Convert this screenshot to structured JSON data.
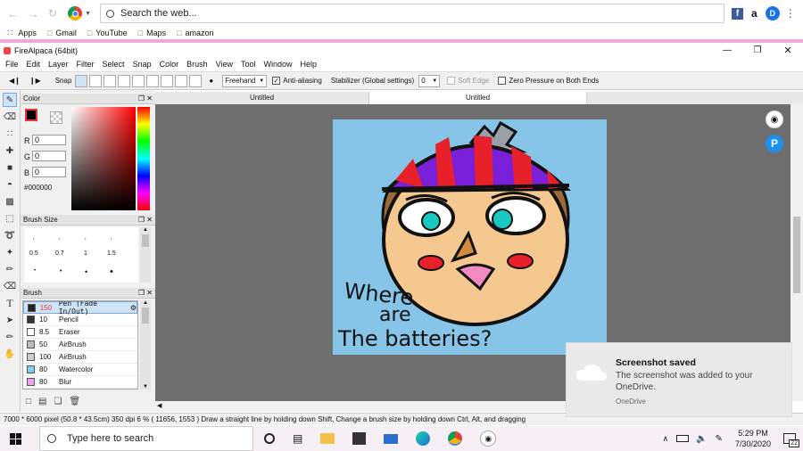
{
  "browser": {
    "omnibox_placeholder": "Search the web...",
    "bookmarks": [
      "Apps",
      "Gmail",
      "YouTube",
      "Maps",
      "amazon"
    ],
    "ext_amazon": "a",
    "ext_profile": "D"
  },
  "app": {
    "title": "FireAlpaca (64bit)",
    "menu": [
      "File",
      "Edit",
      "Layer",
      "Filter",
      "Select",
      "Snap",
      "Color",
      "Brush",
      "View",
      "Tool",
      "Window",
      "Help"
    ]
  },
  "toolbar": {
    "snap_label": "Snap",
    "mode_select": "Freehand",
    "antialias_label": "Anti-aliasing",
    "antialias_checked": true,
    "stabilizer_label": "Stabilizer (Global settings)",
    "stabilizer_value": "0",
    "soft_edge_label": "Soft Edge",
    "zero_pressure_label": "Zero Pressure on Both Ends"
  },
  "tabs": [
    "Untitled",
    "Untitled"
  ],
  "color_panel": {
    "title": "Color",
    "r_label": "R",
    "r_value": "0",
    "g_label": "G",
    "g_value": "0",
    "b_label": "B",
    "b_value": "0",
    "hex": "#000000"
  },
  "brush_size_panel": {
    "title": "Brush Size",
    "sizes": [
      "0.5",
      "0.7",
      "1",
      "1.5"
    ]
  },
  "brush_panel": {
    "title": "Brush",
    "items": [
      {
        "size": "150",
        "name": "Pen (Fade In/Out)",
        "color": "#222222",
        "selected": true
      },
      {
        "size": "10",
        "name": "Pencil",
        "color": "#333333"
      },
      {
        "size": "8.5",
        "name": "Eraser",
        "color": "#ffffff"
      },
      {
        "size": "50",
        "name": "AirBrush",
        "color": "#bbbbbb"
      },
      {
        "size": "100",
        "name": "AirBrush",
        "color": "#cccccc"
      },
      {
        "size": "80",
        "name": "Watercolor",
        "color": "#7fd0f0"
      },
      {
        "size": "80",
        "name": "Blur",
        "color": "#f0a0f0"
      }
    ]
  },
  "artwork": {
    "text_line1": "Where",
    "text_line2": "are",
    "text_line3": "The batteries?",
    "bg_color": "#86c5e8"
  },
  "status": {
    "text": "7000 * 6000 pixel  (50.8 * 43.5cm)  350 dpi  6 %  ( 11656, 1553 )  Draw a straight line by holding down Shift, Change a brush size by holding down Ctrl, Alt, and dragging"
  },
  "toast": {
    "title": "Screenshot saved",
    "body": "The screenshot was added to your OneDrive.",
    "source": "OneDrive"
  },
  "taskbar": {
    "search_placeholder": "Type here to search",
    "time": "5:29 PM",
    "date": "7/30/2020",
    "notif_count": "22"
  }
}
